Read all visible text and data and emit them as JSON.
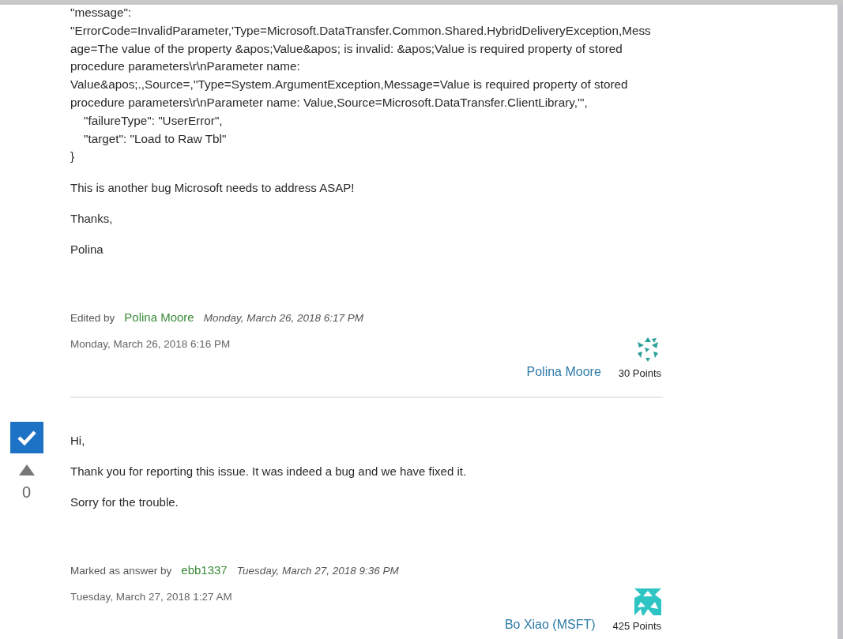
{
  "posts": [
    {
      "body": [
        {
          "kind": "code",
          "lines": [
            "\"message\":",
            "\"ErrorCode=InvalidParameter,'Type=Microsoft.DataTransfer.Common.Shared.HybridDeliveryException,Mess",
            "age=The value of the property &apos;Value&apos; is invalid: &apos;Value is required property of stored",
            "procedure parameters\\r\\nParameter name:",
            "Value&apos;.,Source=,''Type=System.ArgumentException,Message=Value is required property of stored",
            "procedure parameters\\r\\nParameter name: Value,Source=Microsoft.DataTransfer.ClientLibrary,'\",",
            "    \"failureType\": \"UserError\",",
            "    \"target\": \"Load to Raw Tbl\"",
            "}"
          ]
        },
        {
          "kind": "text",
          "text": "This is another bug Microsoft needs to address ASAP!"
        },
        {
          "kind": "text",
          "text": "Thanks,"
        },
        {
          "kind": "text",
          "text": "Polina"
        }
      ],
      "note": {
        "label": "Edited by",
        "user": "Polina Moore",
        "time": "Monday, March 26, 2018 6:17 PM"
      },
      "date": "Monday, March 26, 2018 6:16 PM",
      "author": "Polina Moore",
      "points": "30 Points"
    },
    {
      "vote": {
        "checked": true,
        "count": "0"
      },
      "body": [
        {
          "kind": "text",
          "text": "Hi,"
        },
        {
          "kind": "text",
          "text": "Thank you for reporting this issue. It was indeed a bug and we have fixed it."
        },
        {
          "kind": "text",
          "text": "Sorry for the trouble."
        }
      ],
      "note": {
        "label": "Marked as answer by",
        "user": "ebb1337",
        "time": "Tuesday, March 27, 2018 9:36 PM"
      },
      "date": "Tuesday, March 27, 2018 1:27 AM",
      "author": "Bo Xiao (MSFT)",
      "points": "425 Points"
    }
  ]
}
